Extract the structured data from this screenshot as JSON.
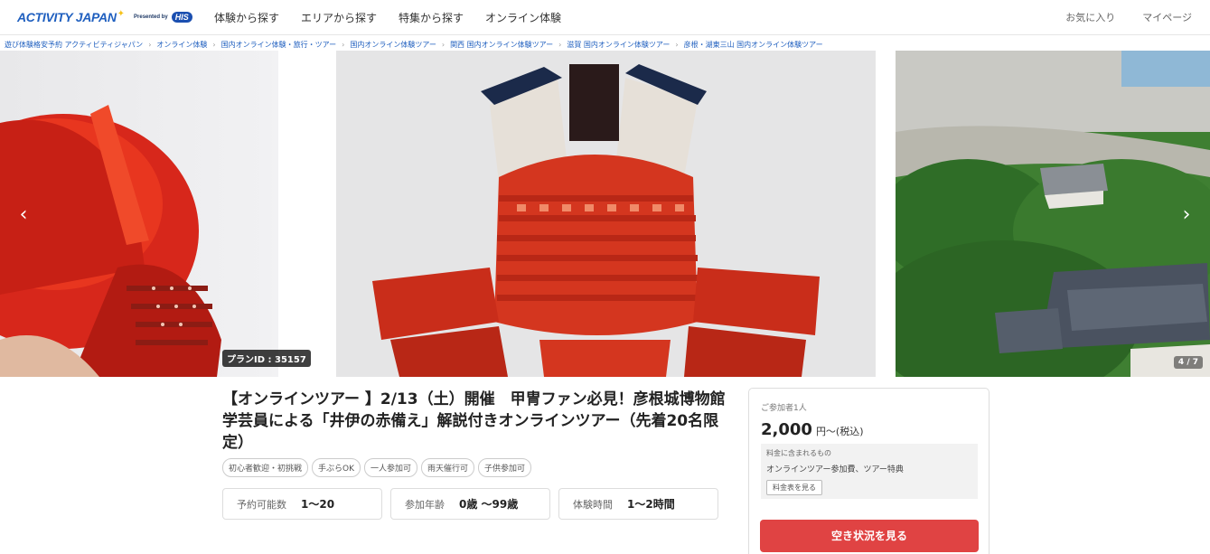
{
  "header": {
    "logo": {
      "text": "ACTIVITY JAPAN",
      "presented_by": "Presented by",
      "partner": "HIS"
    },
    "nav": [
      "体験から探す",
      "エリアから探す",
      "特集から探す",
      "オンライン体験"
    ],
    "right_links": [
      "お気に入り",
      "マイページ"
    ]
  },
  "breadcrumb": [
    "遊び体験格安予約 アクティビティジャパン",
    "オンライン体験",
    "国内オンライン体験・旅行・ツアー",
    "国内オンライン体験ツアー",
    "関西 国内オンライン体験ツアー",
    "滋賀 国内オンライン体験ツアー",
    "彦根・湖東三山 国内オンライン体験ツアー"
  ],
  "gallery": {
    "plan_id": "プランID : 35157",
    "counter": "4 / 7",
    "prev_icon": "chevron-left-icon",
    "next_icon": "chevron-right-icon"
  },
  "title": "【オンラインツアー 】2/13（土）開催　甲冑ファン必見！彦根城博物館学芸員による「井伊の赤備え」解説付きオンラインツアー（先着20名限定）",
  "tags": [
    "初心者歓迎・初挑戦",
    "手ぶらOK",
    "一人参加可",
    "雨天催行可",
    "子供参加可"
  ],
  "info": [
    {
      "label": "予約可能数",
      "value": "1〜20"
    },
    {
      "label": "参加年齢",
      "value": "0歳 〜99歳"
    },
    {
      "label": "体験時間",
      "value": "1〜2時間"
    }
  ],
  "price_card": {
    "people": "ご参加者1人",
    "price": "2,000",
    "suffix": "円〜(税込)",
    "included_caption": "料金に含まれるもの",
    "included": "オンラインツアー参加費、ツアー特典",
    "fee_button": "料金表を見る",
    "cta": "空き状況を見る"
  },
  "colors": {
    "brand": "#1f5fbf",
    "cta": "#e04343"
  }
}
